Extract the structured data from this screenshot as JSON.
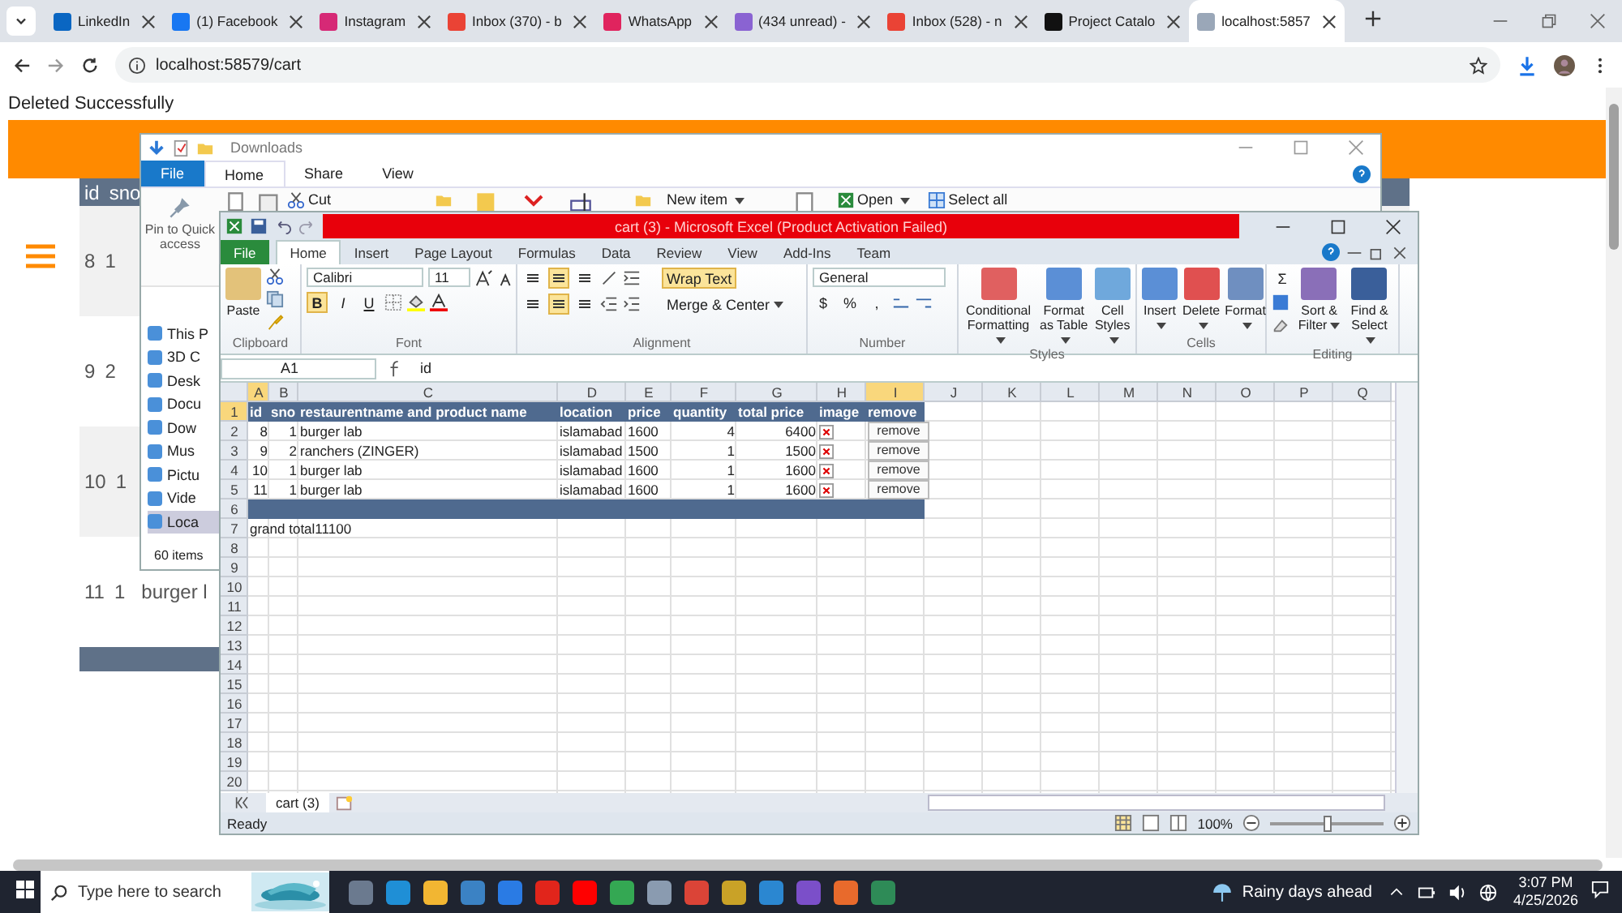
{
  "browser": {
    "tabs": [
      {
        "title": "LinkedIn",
        "selected": false,
        "color": "#0a66c2"
      },
      {
        "title": "(1) Facebook",
        "selected": false,
        "color": "#1877f2"
      },
      {
        "title": "Instagram",
        "selected": false,
        "color": "#d62976"
      },
      {
        "title": "Inbox (370) - b",
        "selected": false,
        "color": "#ea4335"
      },
      {
        "title": "WhatsApp",
        "selected": false,
        "color": "#e0245e"
      },
      {
        "title": "(434 unread) -",
        "selected": false,
        "color": "#8a63d2"
      },
      {
        "title": "Inbox (528) - n",
        "selected": false,
        "color": "#ea4335"
      },
      {
        "title": "Project Catalo",
        "selected": false,
        "color": "#111111"
      },
      {
        "title": "localhost:5857",
        "selected": true,
        "color": "#9aa7b8"
      }
    ],
    "address": "localhost:58579/cart"
  },
  "page": {
    "message": "Deleted Successfully",
    "table": {
      "headers": [
        "id",
        "sno"
      ],
      "rows": [
        {
          "cells": [
            "8",
            "1"
          ]
        },
        {
          "cells": [
            "9",
            "2"
          ]
        },
        {
          "cells": [
            "10",
            "1"
          ]
        },
        {
          "cells": [
            "11",
            "1",
            "burger l"
          ]
        }
      ]
    }
  },
  "explorer": {
    "title": "Downloads",
    "tabs": [
      {
        "label": "File",
        "kind": "file",
        "selected": false
      },
      {
        "label": "Home",
        "kind": "tab",
        "selected": true
      },
      {
        "label": "Share",
        "kind": "tab",
        "selected": false
      },
      {
        "label": "View",
        "kind": "tab",
        "selected": false
      }
    ],
    "pin": "Pin to Quick access",
    "cut": "Cut",
    "new_item": "New item",
    "open": "Open",
    "select_all": "Select all",
    "nav": [
      {
        "label": "This P",
        "selected": false
      },
      {
        "label": "3D C",
        "selected": false
      },
      {
        "label": "Desk",
        "selected": false
      },
      {
        "label": "Docu",
        "selected": false
      },
      {
        "label": "Dow",
        "selected": false
      },
      {
        "label": "Mus",
        "selected": false
      },
      {
        "label": "Pictu",
        "selected": false
      },
      {
        "label": "Vide",
        "selected": false
      },
      {
        "label": "Loca",
        "selected": true
      }
    ],
    "status": "60 items"
  },
  "excel": {
    "title": "cart (3) - Microsoft Excel (Product Activation Failed)",
    "tabs": [
      {
        "label": "File",
        "kind": "file",
        "selected": false
      },
      {
        "label": "Home",
        "kind": "tab",
        "selected": true
      },
      {
        "label": "Insert",
        "kind": "tab",
        "selected": false
      },
      {
        "label": "Page Layout",
        "kind": "tab",
        "selected": false
      },
      {
        "label": "Formulas",
        "kind": "tab",
        "selected": false
      },
      {
        "label": "Data",
        "kind": "tab",
        "selected": false
      },
      {
        "label": "Review",
        "kind": "tab",
        "selected": false
      },
      {
        "label": "View",
        "kind": "tab",
        "selected": false
      },
      {
        "label": "Add-Ins",
        "kind": "tab",
        "selected": false
      },
      {
        "label": "Team",
        "kind": "tab",
        "selected": false
      }
    ],
    "ribbon": [
      {
        "kind": "clipboard",
        "label": "Clipboard",
        "paste": "Paste"
      },
      {
        "kind": "font",
        "label": "Font",
        "font": "Calibri",
        "size": "11",
        "styles": [
          {
            "label": "B",
            "pressed": true
          },
          {
            "label": "I",
            "pressed": false
          },
          {
            "label": "U",
            "pressed": false
          }
        ]
      },
      {
        "kind": "alignment",
        "label": "Alignment",
        "align_buttons": [
          {
            "pressed": false
          },
          {
            "pressed": true
          },
          {
            "pressed": false
          },
          {
            "pressed": false
          },
          {
            "pressed": true
          },
          {
            "pressed": false
          }
        ],
        "wrap": {
          "label": "Wrap Text",
          "pressed": true
        },
        "merge": "Merge & Center"
      },
      {
        "kind": "number",
        "label": "Number",
        "format": "General",
        "symbols": [
          "$",
          "%",
          ","
        ]
      },
      {
        "kind": "big",
        "label": "Styles",
        "buttons": [
          "Conditional Formatting",
          "Format as Table",
          "Cell Styles"
        ]
      },
      {
        "kind": "big",
        "label": "Cells",
        "buttons": [
          "Insert",
          "Delete",
          "Format"
        ]
      },
      {
        "kind": "editing",
        "label": "Editing",
        "sum": "Σ",
        "buttons": [
          "Sort & Filter",
          "Find & Select"
        ]
      }
    ],
    "name_box": "A1",
    "formula": "id",
    "column_headers": [
      {
        "label": "A",
        "selected": true
      },
      {
        "label": "B",
        "selected": false
      },
      {
        "label": "C",
        "selected": false
      },
      {
        "label": "D",
        "selected": false
      },
      {
        "label": "E",
        "selected": false
      },
      {
        "label": "F",
        "selected": false
      },
      {
        "label": "G",
        "selected": false
      },
      {
        "label": "H",
        "selected": false
      },
      {
        "label": "I",
        "selected": true
      },
      {
        "label": "J",
        "selected": false
      },
      {
        "label": "K",
        "selected": false
      },
      {
        "label": "L",
        "selected": false
      },
      {
        "label": "M",
        "selected": false
      },
      {
        "label": "N",
        "selected": false
      },
      {
        "label": "O",
        "selected": false
      },
      {
        "label": "P",
        "selected": false
      },
      {
        "label": "Q",
        "selected": false
      }
    ],
    "row_headers": [
      {
        "label": "1",
        "selected": true
      },
      {
        "label": "2",
        "selected": false
      },
      {
        "label": "3",
        "selected": false
      },
      {
        "label": "4",
        "selected": false
      },
      {
        "label": "5",
        "selected": false
      },
      {
        "label": "6",
        "selected": false
      },
      {
        "label": "7",
        "selected": false
      },
      {
        "label": "8",
        "selected": false
      },
      {
        "label": "9",
        "selected": false
      },
      {
        "label": "10",
        "selected": false
      },
      {
        "label": "11",
        "selected": false
      },
      {
        "label": "12",
        "selected": false
      },
      {
        "label": "13",
        "selected": false
      },
      {
        "label": "14",
        "selected": false
      },
      {
        "label": "15",
        "selected": false
      },
      {
        "label": "16",
        "selected": false
      },
      {
        "label": "17",
        "selected": false
      },
      {
        "label": "18",
        "selected": false
      },
      {
        "label": "19",
        "selected": false
      },
      {
        "label": "20",
        "selected": false
      }
    ],
    "rows": [
      {
        "kind": "header",
        "cells": [
          "id",
          "sno",
          "restaurentname and product name",
          "location",
          "price",
          "quantity",
          "total price",
          "image",
          "remove"
        ]
      },
      {
        "kind": "data",
        "cells": [
          "8",
          "1",
          "burger lab",
          "islamabad",
          "1600",
          "4",
          "6400"
        ],
        "button": "remove"
      },
      {
        "kind": "data",
        "cells": [
          "9",
          "2",
          "ranchers (ZINGER)",
          "islamabad",
          "1500",
          "1",
          "1500"
        ],
        "button": "remove"
      },
      {
        "kind": "data",
        "cells": [
          "10",
          "1",
          "burger lab",
          "islamabad",
          "1600",
          "1",
          "1600"
        ],
        "button": "remove"
      },
      {
        "kind": "data",
        "cells": [
          "11",
          "1",
          "burger lab",
          "islamabad",
          "1600",
          "1",
          "1600"
        ],
        "button": "remove"
      },
      {
        "kind": "band",
        "cells": []
      },
      {
        "kind": "total",
        "cells": [
          "grand total11100"
        ]
      }
    ],
    "sheet_tab": "cart (3)",
    "status": "Ready",
    "zoom": "100%",
    "zoom_slider": {
      "level": 0.5
    }
  },
  "taskbar": {
    "search": "Type here to search",
    "apps": [
      {
        "color": "#6b7a8f"
      },
      {
        "color": "#1f8fd6"
      },
      {
        "color": "#f2b632"
      },
      {
        "color": "#3b82c4"
      },
      {
        "color": "#2a7be4"
      },
      {
        "color": "#e1251b"
      },
      {
        "color": "#ff0000"
      },
      {
        "color": "#34a853"
      },
      {
        "color": "#8a9bb0"
      },
      {
        "color": "#db4437"
      },
      {
        "color": "#c9a227"
      },
      {
        "color": "#2b87d1"
      },
      {
        "color": "#7b4fc9"
      },
      {
        "color": "#e86a2c"
      },
      {
        "color": "#2e8b57"
      }
    ],
    "weather": "Rainy days ahead",
    "time": "3:07 PM",
    "date": "4/25/2026"
  }
}
